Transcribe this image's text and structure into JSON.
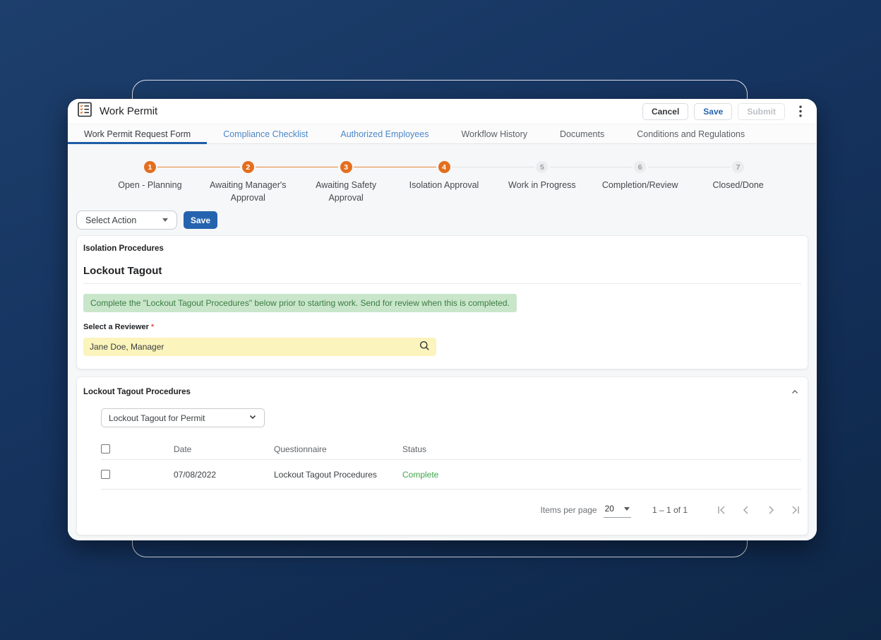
{
  "window": {
    "title": "Work Permit",
    "actions": {
      "cancel": "Cancel",
      "save": "Save",
      "submit": "Submit"
    }
  },
  "tabs": [
    {
      "label": "Work Permit Request Form",
      "state": "active"
    },
    {
      "label": "Compliance Checklist",
      "state": "link"
    },
    {
      "label": "Authorized Employees",
      "state": "link"
    },
    {
      "label": "Workflow History",
      "state": "default"
    },
    {
      "label": "Documents",
      "state": "default"
    },
    {
      "label": "Conditions and Regulations",
      "state": "default"
    }
  ],
  "stepper": {
    "steps": [
      {
        "number": "1",
        "label": "Open - Planning",
        "state": "done"
      },
      {
        "number": "2",
        "label": "Awaiting Manager's Approval",
        "state": "done"
      },
      {
        "number": "3",
        "label": "Awaiting Safety Approval",
        "state": "done"
      },
      {
        "number": "4",
        "label": "Isolation Approval",
        "state": "done"
      },
      {
        "number": "5",
        "label": "Work in Progress",
        "state": "upcoming"
      },
      {
        "number": "6",
        "label": "Completion/Review",
        "state": "upcoming"
      },
      {
        "number": "7",
        "label": "Closed/Done",
        "state": "upcoming"
      }
    ]
  },
  "action_bar": {
    "select_action_label": "Select Action",
    "save_label": "Save"
  },
  "isolation_card": {
    "section_title": "Isolation Procedures",
    "heading": "Lockout Tagout",
    "notice": "Complete the \"Lockout Tagout Procedures\" below prior to starting work. Send for review when this is completed.",
    "reviewer_label": "Select a Reviewer",
    "required_marker": "*",
    "reviewer_value": "Jane Doe, Manager"
  },
  "procedures_card": {
    "section_title": "Lockout Tagout Procedures",
    "template_select_value": "Lockout Tagout for Permit",
    "table": {
      "columns": [
        "Date",
        "Questionnaire",
        "Status"
      ],
      "rows": [
        {
          "date": "07/08/2022",
          "questionnaire": "Lockout Tagout Procedures",
          "status": "Complete"
        }
      ]
    },
    "pagination": {
      "items_per_page_label": "Items per page",
      "items_per_page_value": "20",
      "range_label": "1 – 1 of 1"
    }
  },
  "colors": {
    "accent_orange": "#e36f1e",
    "accent_blue": "#2563ae",
    "tab_link_blue": "#4c87c8",
    "status_complete_green": "#3fa54a",
    "notice_green_bg": "#c9e6cb",
    "notice_green_text": "#3b7d41",
    "reviewer_field_bg": "#fbf4bc",
    "background_navy": "#163460"
  }
}
